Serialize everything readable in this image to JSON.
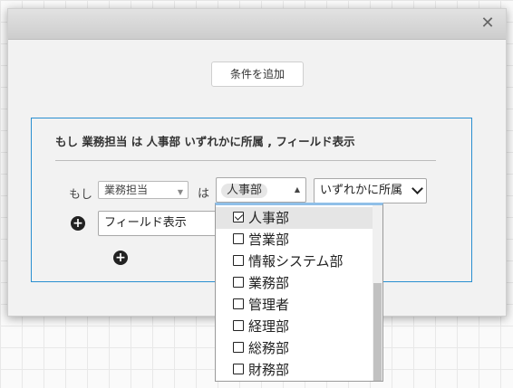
{
  "modal": {
    "close_glyph": "✕",
    "add_condition_label": "条件を追加"
  },
  "panel": {
    "summary": "もし 業務担当 は 人事部 いずれかに所属 , フィールド表示",
    "if_label": "もし",
    "field_select": "業務担当",
    "is_label": "は",
    "selected_value_chip": "人事部",
    "operator_select": "いずれかに所属",
    "action_select": "フィールド表示"
  },
  "dropdown": {
    "items": [
      {
        "label": "人事部",
        "checked": true
      },
      {
        "label": "営業部",
        "checked": false
      },
      {
        "label": "情報システム部",
        "checked": false
      },
      {
        "label": "業務部",
        "checked": false
      },
      {
        "label": "管理者",
        "checked": false
      },
      {
        "label": "経理部",
        "checked": false
      },
      {
        "label": "総務部",
        "checked": false
      },
      {
        "label": "財務部",
        "checked": false
      }
    ]
  }
}
